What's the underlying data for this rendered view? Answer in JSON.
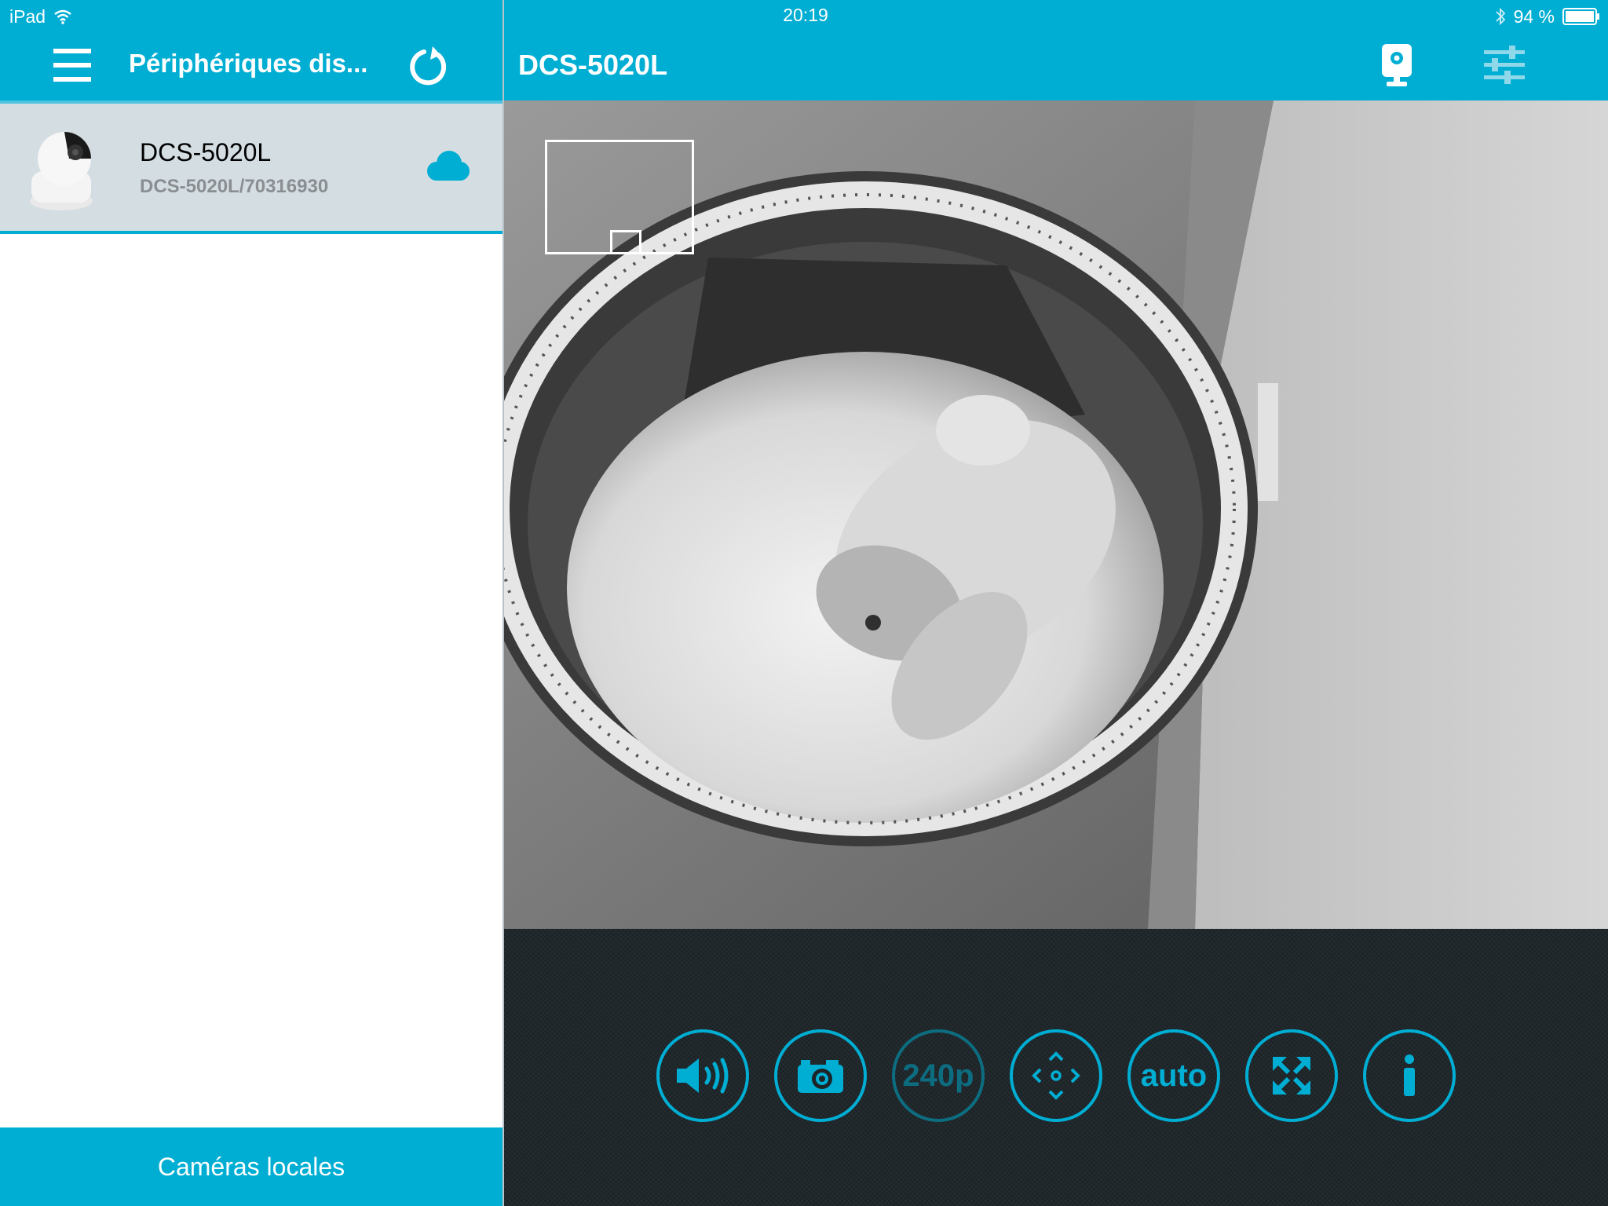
{
  "status_bar": {
    "device": "iPad",
    "time": "20:19",
    "battery": "94 %"
  },
  "left_panel": {
    "title": "Périphériques dis...",
    "devices": [
      {
        "name": "DCS-5020L",
        "subtitle": "DCS-5020L/70316930",
        "connection_icon": "cloud-icon"
      }
    ],
    "footer_button": "Caméras locales"
  },
  "right_panel": {
    "camera_title": "DCS-5020L",
    "controls": {
      "audio_icon": "speaker-icon",
      "snapshot_icon": "camera-icon",
      "resolution": "240p",
      "pan_tilt_icon": "pan-tilt-icon",
      "auto": "auto",
      "fullscreen_icon": "expand-icon",
      "info_icon": "info-icon"
    }
  },
  "colors": {
    "accent": "#00aed3",
    "selected_row": "#d3dde2",
    "controls_bg": "#1d2428"
  }
}
